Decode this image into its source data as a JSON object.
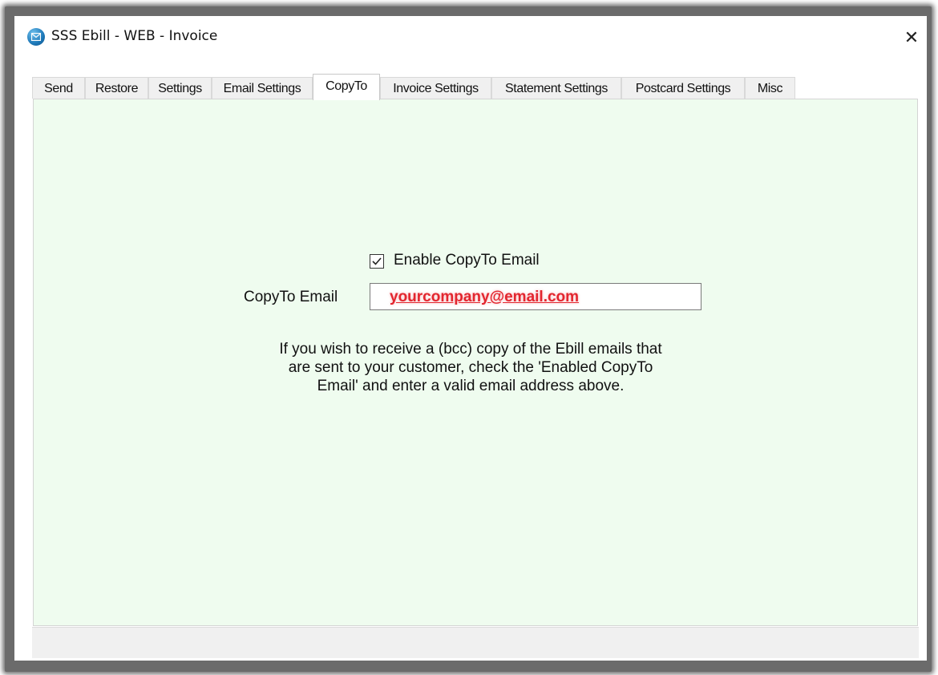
{
  "window": {
    "title": "SSS Ebill - WEB - Invoice",
    "close_symbol": "✕",
    "icon": "email-app-icon"
  },
  "tabs": [
    {
      "label": "Send"
    },
    {
      "label": "Restore"
    },
    {
      "label": "Settings"
    },
    {
      "label": "Email Settings"
    },
    {
      "label": "CopyTo",
      "active": true
    },
    {
      "label": "Invoice Settings"
    },
    {
      "label": "Statement Settings"
    },
    {
      "label": "Postcard Settings"
    },
    {
      "label": "Misc"
    }
  ],
  "copyto": {
    "enable_label": "Enable CopyTo Email",
    "enable_checked": true,
    "email_label": "CopyTo Email",
    "email_value": "yourcompany@email.com",
    "help_text": "If you wish to receive a (bcc) copy of the Ebill emails that\nare sent to your customer, check the 'Enabled CopyTo\nEmail' and enter a valid email address above."
  },
  "colors": {
    "panel_bg": "#effcef",
    "email_text": "#e3262f"
  }
}
